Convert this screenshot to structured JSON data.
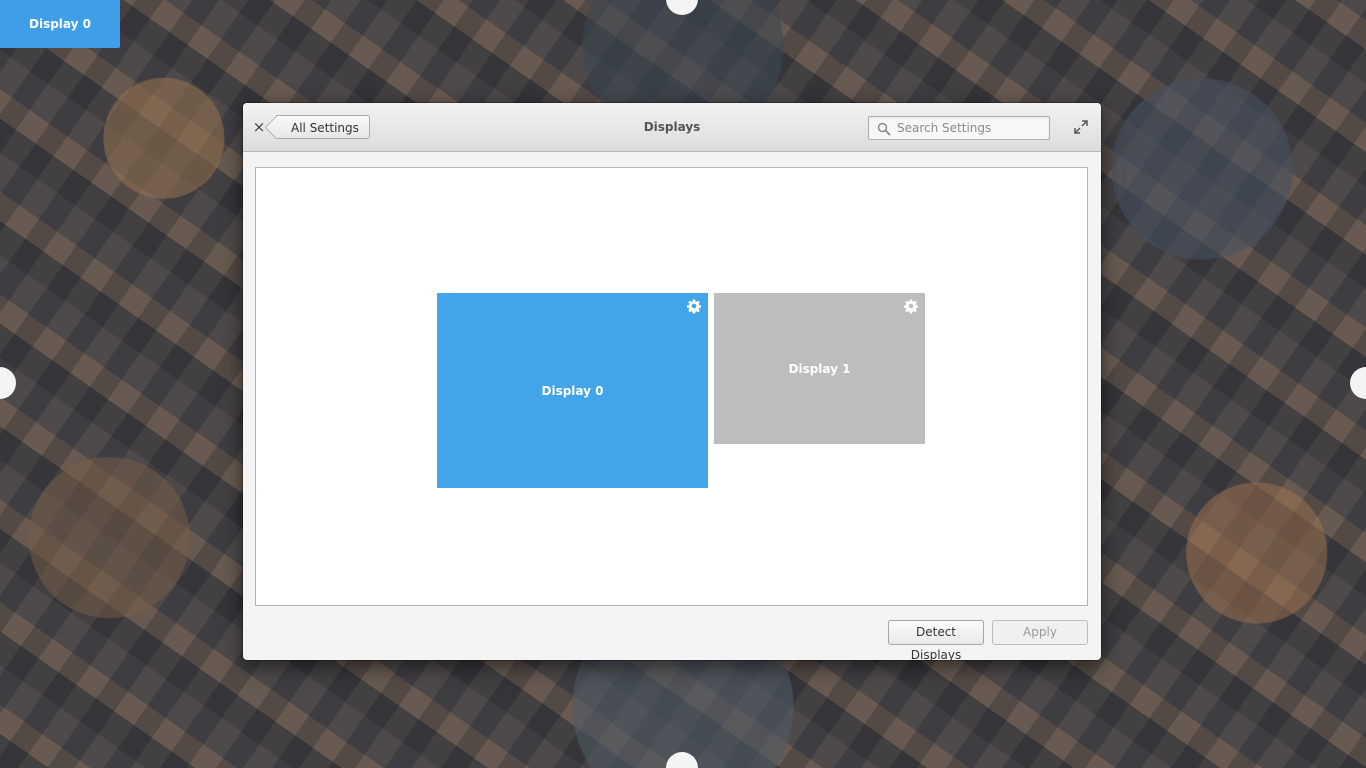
{
  "desktop": {
    "identify_badge": "Display 0"
  },
  "window": {
    "title": "Displays",
    "back_label": "All Settings",
    "close_glyph": "×",
    "search": {
      "placeholder": "Search Settings",
      "value": ""
    },
    "icons": {
      "search": "search-icon",
      "maximize": "maximize-icon",
      "gear": "gear-icon"
    }
  },
  "arrangement": {
    "displays": [
      {
        "label": "Display 0",
        "color": "#42a5e8",
        "primary": true
      },
      {
        "label": "Display 1",
        "color": "#bdbdbd",
        "primary": false
      }
    ]
  },
  "actions": {
    "detect_label": "Detect Displays",
    "apply_label": "Apply"
  }
}
